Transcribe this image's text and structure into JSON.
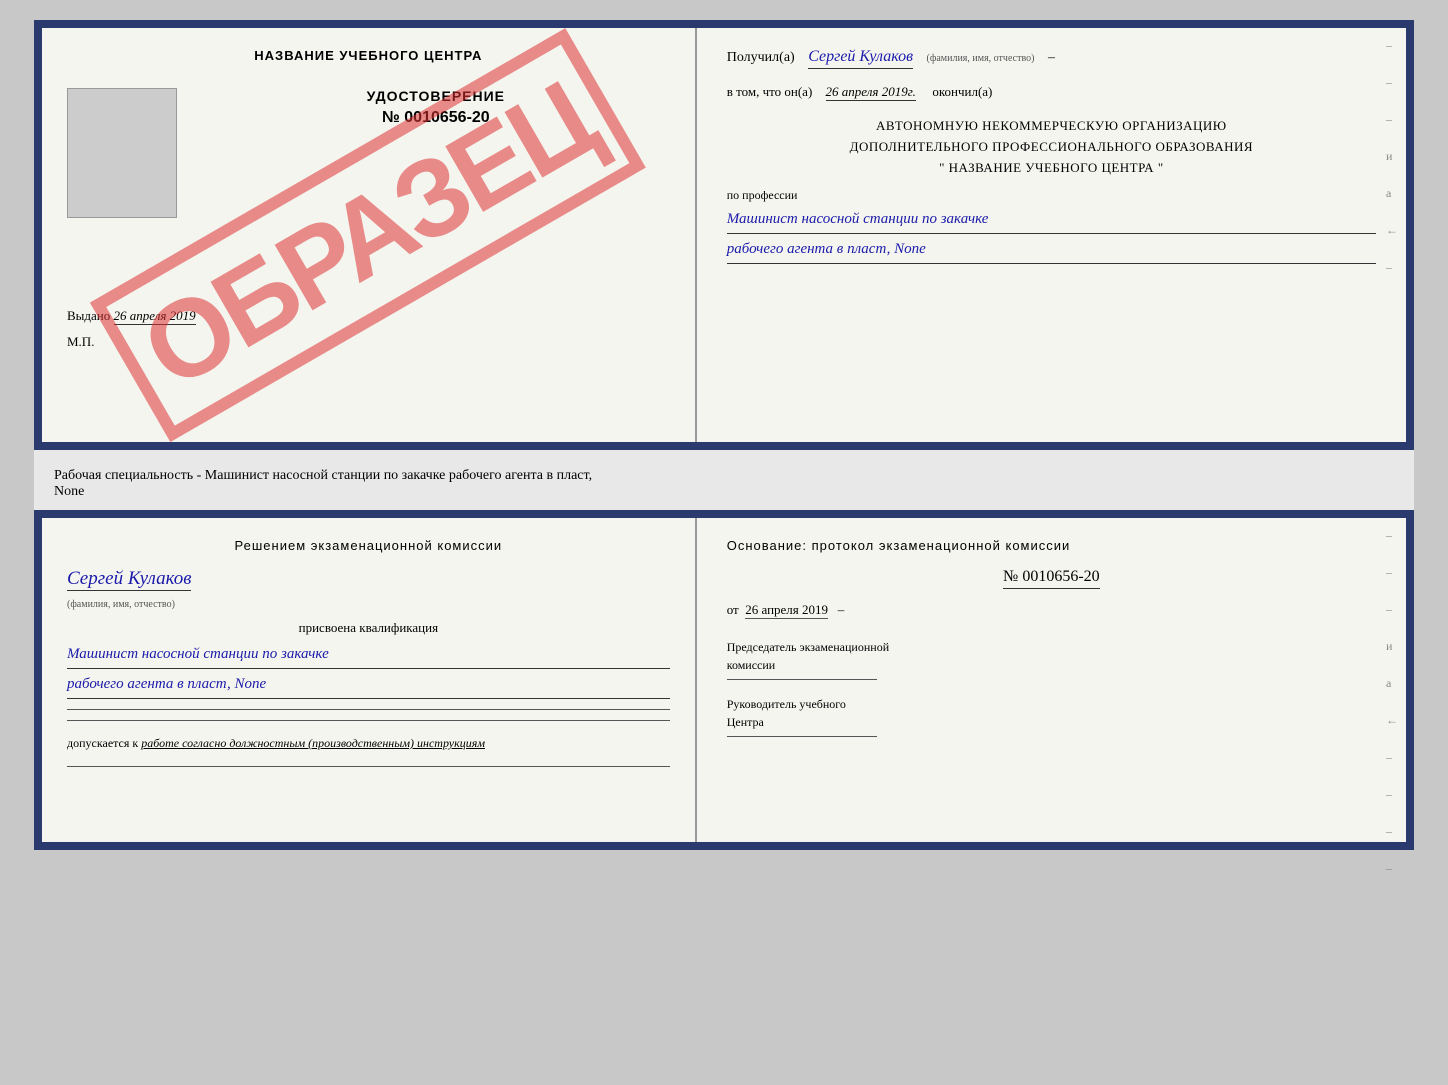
{
  "top_left": {
    "title": "НАЗВАНИЕ УЧЕБНОГО ЦЕНТРА",
    "watermark": "ОБРАЗЕЦ",
    "cert_type": "УДОСТОВЕРЕНИЕ",
    "cert_number": "№ 0010656-20",
    "issued_label": "Выдано",
    "issued_date": "26 апреля 2019",
    "mp_label": "М.П."
  },
  "top_right": {
    "received_label": "Получил(а)",
    "received_name": "Сергей Кулаков",
    "fio_hint": "(фамилия, имя, отчество)",
    "date_prefix": "в том, что он(а)",
    "date_value": "26 апреля 2019г.",
    "date_suffix": "окончил(а)",
    "org_line1": "АВТОНОМНУЮ НЕКОММЕРЧЕСКУЮ ОРГАНИЗАЦИЮ",
    "org_line2": "ДОПОЛНИТЕЛЬНОГО ПРОФЕССИОНАЛЬНОГО ОБРАЗОВАНИЯ",
    "org_line3": "\" НАЗВАНИЕ УЧЕБНОГО ЦЕНТРА \"",
    "profession_label": "по профессии",
    "profession_line1": "Машинист насосной станции по закачке",
    "profession_line2": "рабочего агента в пласт, None"
  },
  "middle": {
    "text": "Рабочая специальность - Машинист насосной станции по закачке рабочего агента в пласт,",
    "text2": "None"
  },
  "bottom_left": {
    "commission_title": "Решением экзаменационной комиссии",
    "person_name": "Сергей Кулаков",
    "fio_hint": "(фамилия, имя, отчество)",
    "assigned_label": "присвоена квалификация",
    "qualification_line1": "Машинист насосной станции по закачке",
    "qualification_line2": "рабочего агента в пласт, None",
    "allowed_prefix": "допускается к",
    "allowed_value": "работе согласно должностным (производственным) инструкциям"
  },
  "bottom_right": {
    "basis_title": "Основание: протокол экзаменационной комиссии",
    "protocol_number": "№ 0010656-20",
    "date_prefix": "от",
    "date_value": "26 апреля 2019",
    "chairman_label1": "Председатель экзаменационной",
    "chairman_label2": "комиссии",
    "director_label1": "Руководитель учебного",
    "director_label2": "Центра"
  },
  "side_marks": [
    "-",
    "-",
    "-",
    "и",
    "а",
    "←",
    "-",
    "-",
    "-",
    "-"
  ]
}
